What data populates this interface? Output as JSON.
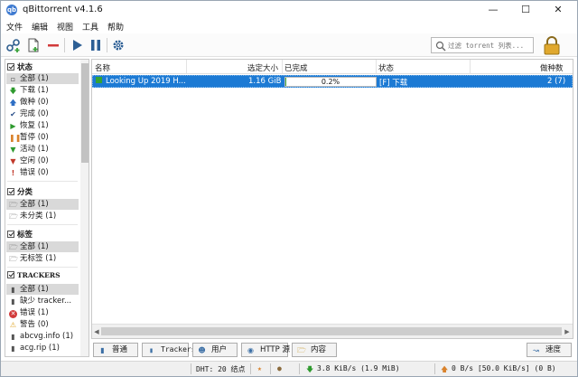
{
  "window": {
    "title": "qBittorrent v4.1.6"
  },
  "menu": [
    "文件",
    "编辑",
    "视图",
    "工具",
    "帮助"
  ],
  "search": {
    "placeholder": "过滤 torrent 列表..."
  },
  "sidebar": {
    "status": {
      "title": "状态",
      "items": [
        {
          "label": "全部 (1)",
          "icon": "all-filter-icon",
          "selected": true
        },
        {
          "label": "下载 (1)",
          "icon": "download-arrow-icon"
        },
        {
          "label": "做种 (0)",
          "icon": "upload-arrow-icon"
        },
        {
          "label": "完成 (0)",
          "icon": "checkmark-icon"
        },
        {
          "label": "恢复 (1)",
          "icon": "play-icon"
        },
        {
          "label": "暂停 (0)",
          "icon": "pause-icon"
        },
        {
          "label": "活动 (1)",
          "icon": "filter-icon"
        },
        {
          "label": "空闲 (0)",
          "icon": "filter-icon"
        },
        {
          "label": "错误 (0)",
          "icon": "exclamation-icon"
        }
      ]
    },
    "categories": {
      "title": "分类",
      "items": [
        {
          "label": "全部 (1)",
          "icon": "folder-icon",
          "selected": true
        },
        {
          "label": "未分类 (1)",
          "icon": "folder-icon"
        }
      ]
    },
    "tags": {
      "title": "标签",
      "items": [
        {
          "label": "全部 (1)",
          "icon": "folder-icon",
          "selected": true
        },
        {
          "label": "无标签 (1)",
          "icon": "folder-icon"
        }
      ]
    },
    "trackers": {
      "title": "TRACKERS",
      "items": [
        {
          "label": "全部 (1)",
          "icon": "server-icon",
          "selected": true
        },
        {
          "label": "缺少 tracker...",
          "icon": "server-icon"
        },
        {
          "label": "错误 (1)",
          "icon": "error-circle-icon"
        },
        {
          "label": "警告 (0)",
          "icon": "warning-icon"
        },
        {
          "label": "abcvg.info (1)",
          "icon": "server-icon"
        },
        {
          "label": "acg.rip (1)",
          "icon": "server-icon"
        }
      ]
    }
  },
  "table": {
    "columns": [
      "名称",
      "选定大小",
      "已完成",
      "状态",
      "做种数"
    ],
    "rows": [
      {
        "name": "Looking Up 2019 H...",
        "size": "1.16 GiB",
        "progress_text": "0.2%",
        "progress": 0.002,
        "status": "[F] 下载",
        "seeds": "2 (7)"
      }
    ]
  },
  "tabs": [
    {
      "label": "普通",
      "icon": "info-icon"
    },
    {
      "label": "Trackers",
      "icon": "tracker-icon"
    },
    {
      "label": "用户",
      "icon": "users-icon"
    },
    {
      "label": "HTTP 源",
      "icon": "globe-icon"
    },
    {
      "label": "内容",
      "icon": "folder-icon"
    },
    {
      "label": "速度",
      "icon": "speed-chart-icon"
    }
  ],
  "status_bar": {
    "dht": "DHT: 20 结点",
    "download": "3.8  KiB/s (1.9  MiB)",
    "upload": "0  B/s [50.0 KiB/s] (0  B)"
  },
  "colors": {
    "selection": "#1c7ad4",
    "progress": "#3ba23b"
  }
}
